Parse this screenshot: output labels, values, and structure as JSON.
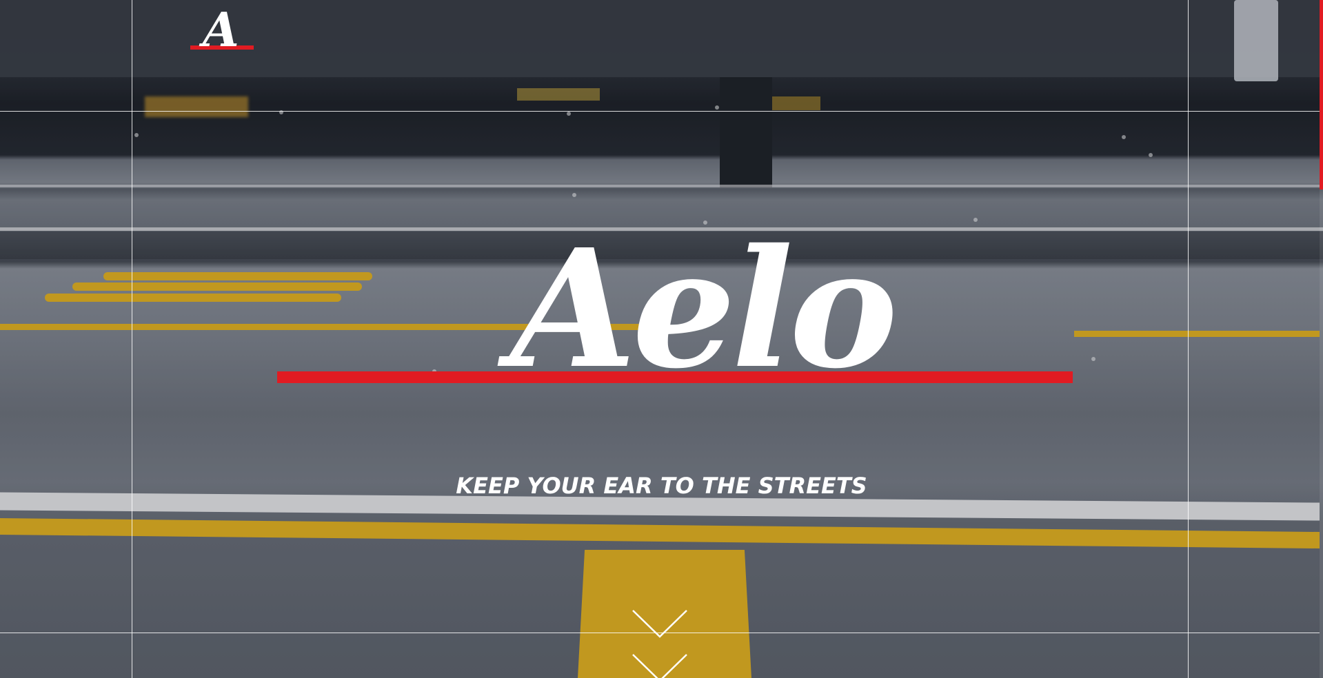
{
  "header": {
    "logo_letter": "A",
    "logo_alt": "Aelo logo"
  },
  "hero": {
    "title": "Aelo",
    "tagline": "KEEP YOUR EAR TO THE STREETS"
  },
  "scroll_hint": {
    "icon": "chevron-down-icon"
  },
  "colors": {
    "accent": "#e11b22",
    "text": "#ffffff",
    "road_yellow": "#e6b21d"
  }
}
